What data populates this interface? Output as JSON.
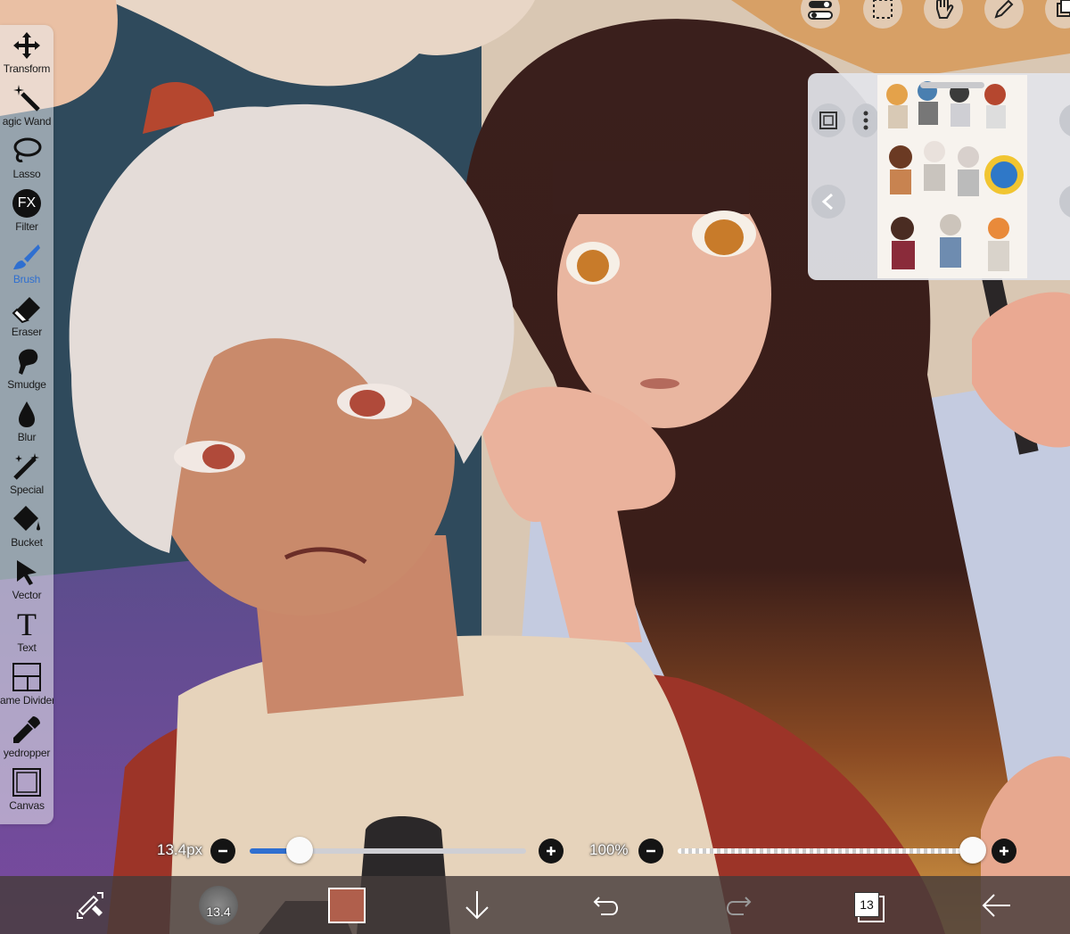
{
  "tools": [
    {
      "label": "Transform",
      "icon": "move-arrows-icon"
    },
    {
      "label": "agic Wand",
      "icon": "magic-wand-icon"
    },
    {
      "label": "Lasso",
      "icon": "lasso-icon"
    },
    {
      "label": "Filter",
      "icon": "fx-icon"
    },
    {
      "label": "Brush",
      "icon": "brush-icon",
      "active": true
    },
    {
      "label": "Eraser",
      "icon": "eraser-icon"
    },
    {
      "label": "Smudge",
      "icon": "smudge-icon"
    },
    {
      "label": "Blur",
      "icon": "blur-drop-icon"
    },
    {
      "label": "Special",
      "icon": "special-icon"
    },
    {
      "label": "Bucket",
      "icon": "bucket-icon"
    },
    {
      "label": "Vector",
      "icon": "vector-arrow-icon"
    },
    {
      "label": "Text",
      "icon": "text-icon"
    },
    {
      "label": "ame Divider",
      "icon": "frame-divider-icon"
    },
    {
      "label": "yedropper",
      "icon": "eyedropper-icon"
    },
    {
      "label": "Canvas",
      "icon": "canvas-icon"
    }
  ],
  "filter_glyph": "FX",
  "text_glyph": "T",
  "brush_size": {
    "label": "13.4px",
    "value_fraction": 0.18
  },
  "opacity": {
    "label": "100%",
    "value_fraction": 1.0
  },
  "bottom_bar": {
    "brush_badge": "13.4",
    "color_swatch": "#b05f4c",
    "layer_count": "13"
  },
  "colors": {
    "accent_blue": "#2f6fd0",
    "toolbar_bg": "#ebecf0"
  }
}
